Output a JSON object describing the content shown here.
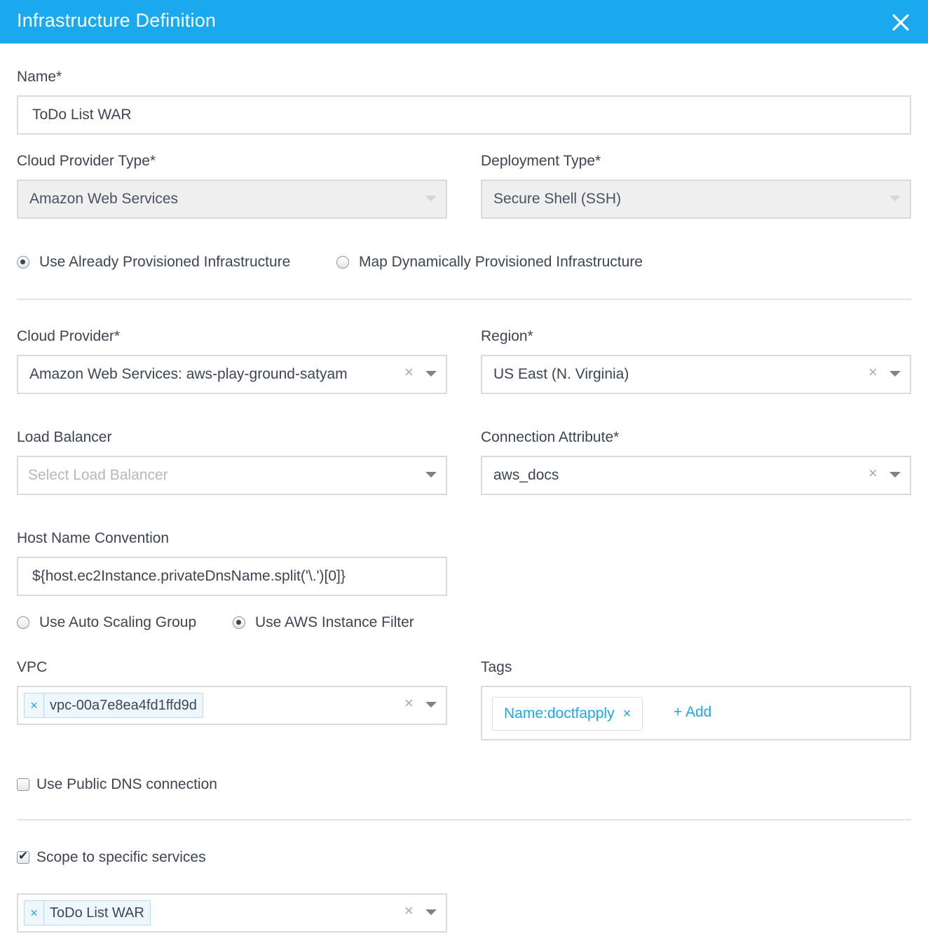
{
  "header": {
    "title": "Infrastructure Definition",
    "close_icon": "close-icon"
  },
  "name_field": {
    "label": "Name*",
    "value": "ToDo List WAR"
  },
  "cloud_provider_type": {
    "label": "Cloud Provider Type*",
    "value": "Amazon Web Services"
  },
  "deployment_type": {
    "label": "Deployment Type*",
    "value": "Secure Shell (SSH)"
  },
  "provision_mode": {
    "options": [
      "Use Already Provisioned Infrastructure",
      "Map Dynamically Provisioned Infrastructure"
    ],
    "selected": "Use Already Provisioned Infrastructure"
  },
  "cloud_provider": {
    "label": "Cloud Provider*",
    "value": "Amazon Web Services: aws-play-ground-satyam",
    "clear": "×"
  },
  "region": {
    "label": "Region*",
    "value": "US East (N. Virginia)",
    "clear": "×"
  },
  "load_balancer": {
    "label": "Load Balancer",
    "placeholder": "Select Load Balancer"
  },
  "connection_attribute": {
    "label": "Connection Attribute*",
    "value": "aws_docs",
    "clear": "×"
  },
  "host_name_convention": {
    "label": "Host Name Convention",
    "value": "${host.ec2Instance.privateDnsName.split('\\.')[0]}"
  },
  "instance_mode": {
    "options": [
      "Use Auto Scaling Group",
      "Use AWS Instance Filter"
    ],
    "selected": "Use AWS Instance Filter"
  },
  "vpc": {
    "label": "VPC",
    "chips": [
      "vpc-00a7e8ea4fd1ffd9d"
    ],
    "chip_remove": "×",
    "clear": "×"
  },
  "tags": {
    "label": "Tags",
    "items": [
      "Name:doctfapply"
    ],
    "remove": "×",
    "add_label": "+ Add"
  },
  "public_dns": {
    "label": "Use Public DNS connection",
    "checked": false
  },
  "scope_services": {
    "label": "Scope to specific services",
    "checked": true,
    "check_mark": "✔"
  },
  "services": {
    "chips": [
      "ToDo List WAR"
    ],
    "chip_remove": "×",
    "clear": "×"
  },
  "colors": {
    "accent": "#1aa9ef",
    "text": "#3d4554",
    "border": "#d8dbe0",
    "disabled_bg": "#efefef"
  }
}
